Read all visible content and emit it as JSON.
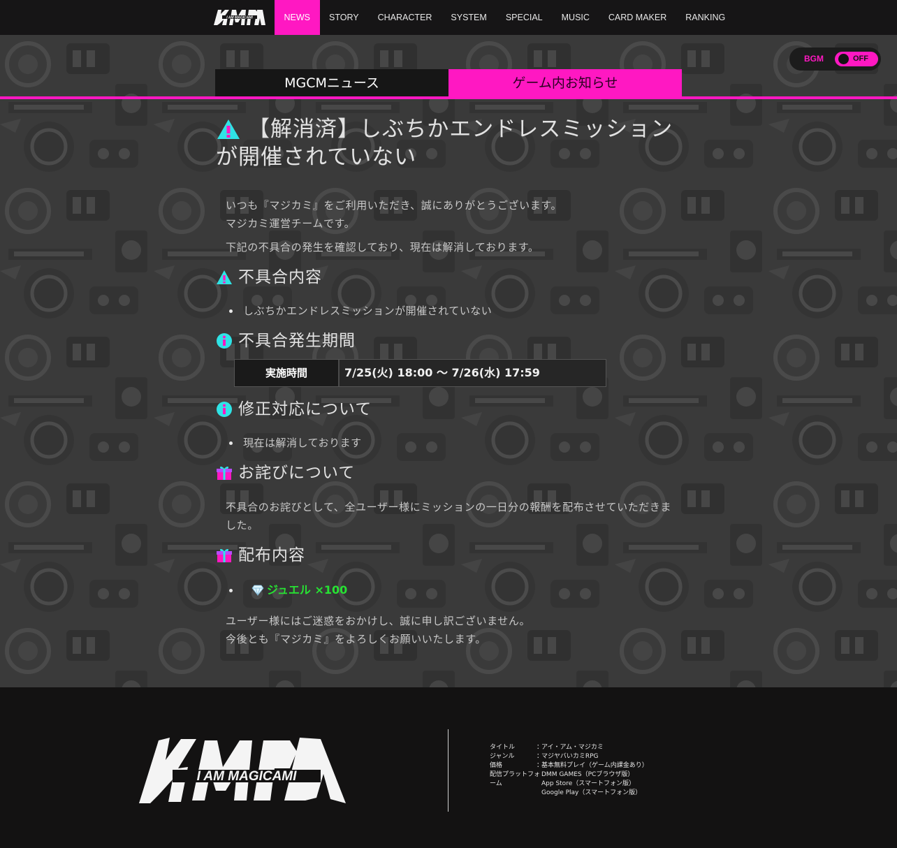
{
  "nav": {
    "logo": "I AM MAGICAMI",
    "items": [
      "NEWS",
      "STORY",
      "CHARACTER",
      "SYSTEM",
      "SPECIAL",
      "MUSIC",
      "CARD MAKER",
      "RANKING"
    ],
    "active_index": 0
  },
  "bgm": {
    "label": "BGM",
    "state": "OFF"
  },
  "tabs": [
    "MGCMニュース",
    "ゲーム内お知らせ"
  ],
  "article": {
    "title": "【解消済】しぶちかエンドレスミッションが開催されていない",
    "intro_line1": "いつも『マジカミ』をご利用いただき、誠にありがとうございます。",
    "intro_line2": "マジカミ運営チームです。",
    "intro_line3": "下記の不具合の発生を確認しており、現在は解消しております。",
    "sec_issue": "不具合内容",
    "issue_item": "しぶちかエンドレスミッションが開催されていない",
    "sec_period": "不具合発生期間",
    "period_key": "実施時間",
    "period_value": "7/25(火) 18:00 〜 7/26(水) 17:59",
    "sec_fix": "修正対応について",
    "fix_item": "現在は解消しております",
    "sec_apology": "お詫びについて",
    "apology_text": "不具合のお詫びとして、全ユーザー様にミッションの一日分の報酬を配布させていただきました。",
    "sec_reward": "配布内容",
    "reward_item": "ジュエル ×100",
    "outro_line1": "ユーザー様にはご迷惑をおかけし、誠に申し訳ございません。",
    "outro_line2": "今後とも『マジカミ』をよろしくお願いいたします。"
  },
  "icons": {
    "warning": "warning-icon",
    "info": "info-icon",
    "gift": "gift-icon",
    "gem": "gem-icon"
  },
  "colors": {
    "accent": "#ff18c2",
    "cyan": "#2fe3e6",
    "reward_green": "#27e233"
  },
  "footer": {
    "logo": "I AM MAGICAMI",
    "info": [
      {
        "key": "タイトル",
        "sep": "：",
        "value": "アイ・アム・マジカミ"
      },
      {
        "key": "ジャンル",
        "sep": "：",
        "value": "マジヤバいカミRPG"
      },
      {
        "key": "価格",
        "sep": "：",
        "value": "基本無料プレイ（ゲーム内課金あり）"
      },
      {
        "key": "配信プラットフォーム",
        "sep": "",
        "value": "DMM GAMES（PCブラウザ版）\nApp Store（スマートフォン版）\nGoogle Play（スマートフォン版）"
      }
    ]
  }
}
